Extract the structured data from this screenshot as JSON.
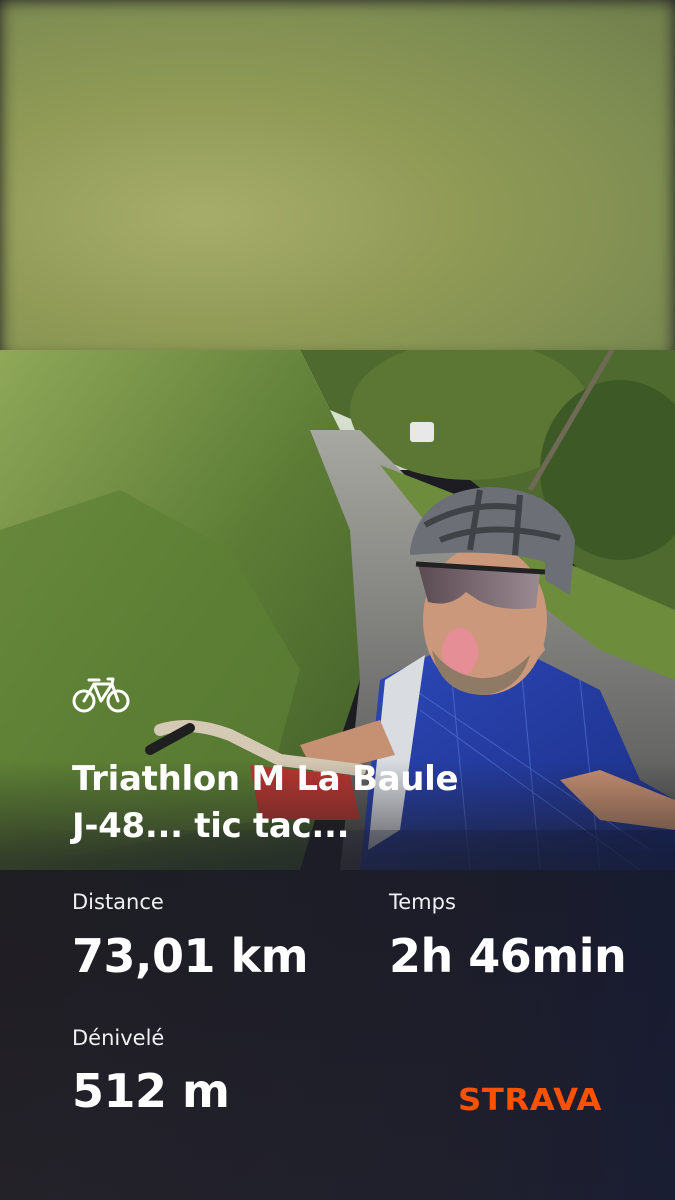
{
  "activity": {
    "type_icon": "bike-icon",
    "title_line1": "Triathlon M La Baule",
    "title_line2": "J-48... tic tac..."
  },
  "stats": [
    {
      "label": "Distance",
      "value": "73,01 km"
    },
    {
      "label": "Temps",
      "value": "2h 46min"
    },
    {
      "label": "Dénivelé",
      "value": "512 m"
    }
  ],
  "brand": {
    "name": "STRAVA",
    "color": "#fc5200"
  },
  "colors": {
    "text": "#ffffff",
    "background": "#242229"
  }
}
